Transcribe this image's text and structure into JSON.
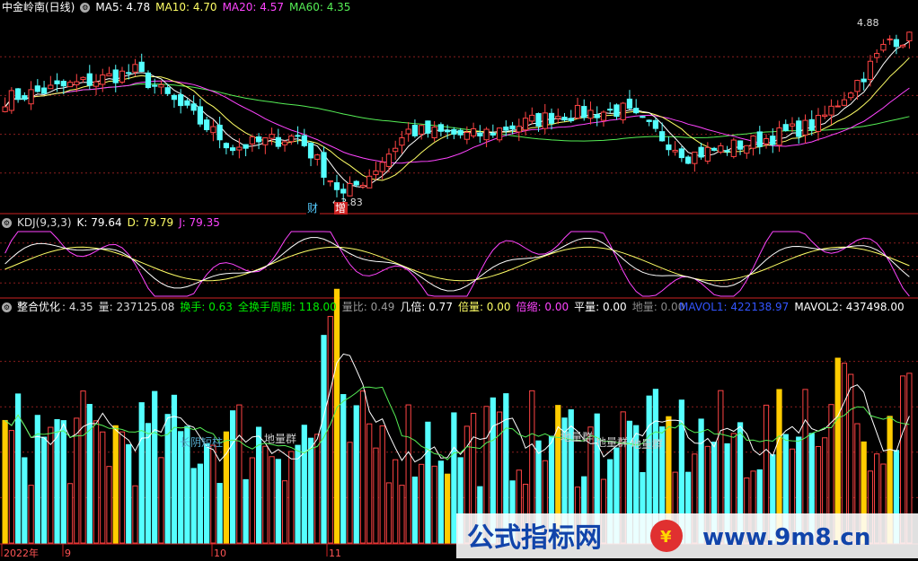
{
  "main": {
    "title": "中金岭南(日线)",
    "ma": [
      {
        "label": "MA5: 4.78",
        "color": "#ffffff"
      },
      {
        "label": "MA10: 4.70",
        "color": "#ffff66"
      },
      {
        "label": "MA20: 4.57",
        "color": "#ff44ff"
      },
      {
        "label": "MA60: 4.35",
        "color": "#55ee55"
      }
    ],
    "price_high_label": "4.88",
    "price_low_label": "3.83",
    "marker_cai": "财",
    "marker_zeng": "增"
  },
  "kdj": {
    "title": "KDJ(9,3,3)",
    "k": "K: 79.64",
    "d": "D: 79.79",
    "j": "J: 79.35"
  },
  "vol": {
    "title": "整合优化",
    "items": [
      {
        "label": ": 4.35",
        "color": "#dddddd"
      },
      {
        "label": "量: 237125.08",
        "color": "#dddddd"
      },
      {
        "label": "换手: 0.63",
        "color": "#00ee00"
      },
      {
        "label": "全换手周期: 118.00",
        "color": "#00ee00"
      },
      {
        "label": "量比: 0.49",
        "color": "#999999"
      },
      {
        "label": "几倍: 0.77",
        "color": "#ffffff"
      },
      {
        "label": "倍量: 0.00",
        "color": "#ffff66"
      },
      {
        "label": "倍缩: 0.00",
        "color": "#ff44ff"
      },
      {
        "label": "平量: 0.00",
        "color": "#ffffff"
      },
      {
        "label": "地量: 0.00",
        "color": "#888888"
      }
    ],
    "mavol1": "MAVOL1: 422138.97",
    "mavol2": "MAVOL2: 437498.00",
    "annot_long_shadow": "长阴短柱",
    "annot_ground": "地量群"
  },
  "axis": {
    "labels": [
      "2022年",
      "9",
      "10",
      "11"
    ]
  },
  "watermark": {
    "cn": "公式指标网",
    "url": "www.9m8.cn"
  },
  "colors": {
    "up": "#ff4444",
    "down": "#55ffff",
    "ma5": "#ffffff",
    "ma10": "#ffff66",
    "ma20": "#ff44ff",
    "ma60": "#55ee55",
    "separator": "#cc2222"
  },
  "chart_data": {
    "type": "candlestick",
    "num_bars": 140,
    "last_close": 4.82,
    "high": 4.88,
    "low": 3.83,
    "ma_last": {
      "ma5": 4.78,
      "ma10": 4.7,
      "ma20": 4.57,
      "ma60": 4.35
    },
    "kdj_last": {
      "k": 79.64,
      "d": 79.79,
      "j": 79.35
    },
    "volume_last": 237125.08,
    "mavol_last": {
      "mavol1": 422138.97,
      "mavol2": 437498.0
    }
  }
}
